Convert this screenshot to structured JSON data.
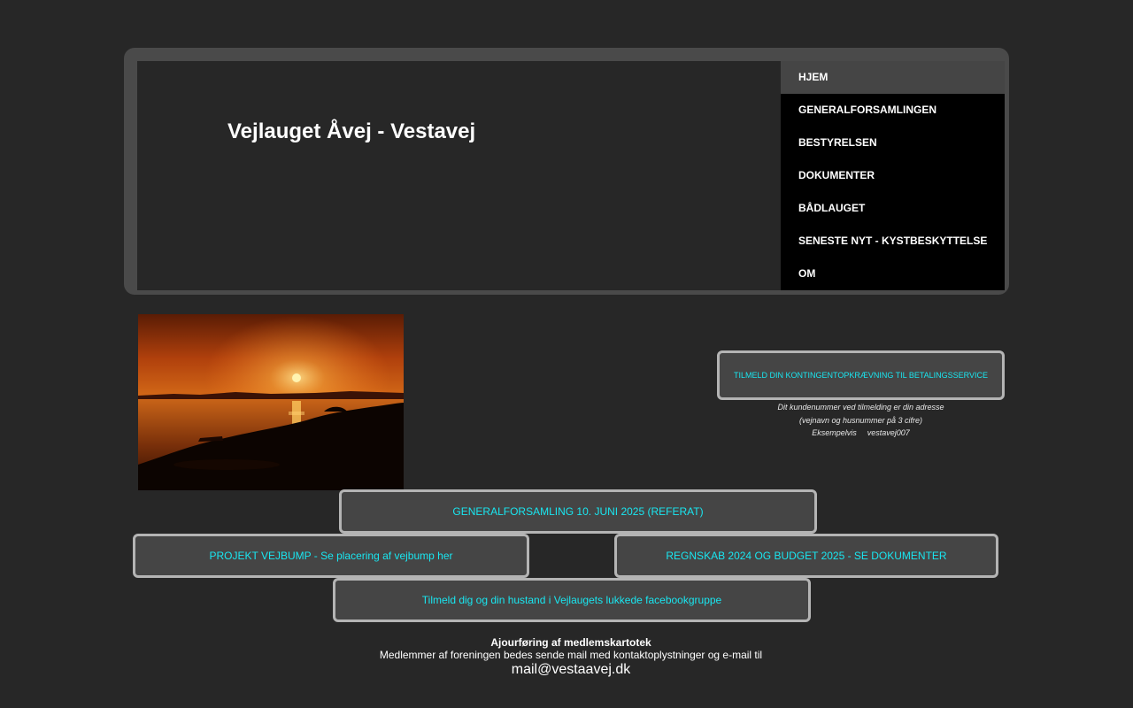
{
  "header": {
    "site_title": "Vejlauget Åvej - Vestavej"
  },
  "nav": {
    "items": [
      {
        "label": "HJEM",
        "active": true
      },
      {
        "label": "GENERALFORSAMLINGEN"
      },
      {
        "label": "BESTYRELSEN"
      },
      {
        "label": "DOKUMENTER"
      },
      {
        "label": "BÅDLAUGET"
      },
      {
        "label": "SENESTE NYT - KYSTBESKYTTELSE"
      },
      {
        "label": "OM"
      }
    ]
  },
  "betalingsservice": {
    "button_label": "TILMELD DIN KONTINGENTOPKRÆVNING TIL BETALINGSSERVICE",
    "note_line1": "Dit kundenummer ved tilmelding er din adresse",
    "note_line2": "(vejnavn og husnummer på 3 cifre)",
    "note_example_label": "Eksempelvis",
    "note_example_value": "vestavej007"
  },
  "buttons": {
    "generalforsamling": "GENERALFORSAMLING 10. JUNI 2025 (REFERAT)",
    "projekt_vejbump": "PROJEKT VEJBUMP - Se placering af vejbump her",
    "regnskab": "REGNSKAB 2024 OG BUDGET 2025 - SE DOKUMENTER",
    "facebook": "Tilmeld dig og din hustand i Vejlaugets lukkede facebookgruppe"
  },
  "footer": {
    "title": "Ajourføring af medlemskartotek",
    "text": "Medlemmer af foreningen bedes sende mail med kontaktoplystninger og e-mail til",
    "email": "mail@vestaavej.dk"
  },
  "colors": {
    "background": "#272727",
    "header_frame": "#4a4a4a",
    "nav_background": "#000000",
    "nav_active": "#454545",
    "button_text": "#19e6f0",
    "button_border": "#b4b4b4"
  }
}
